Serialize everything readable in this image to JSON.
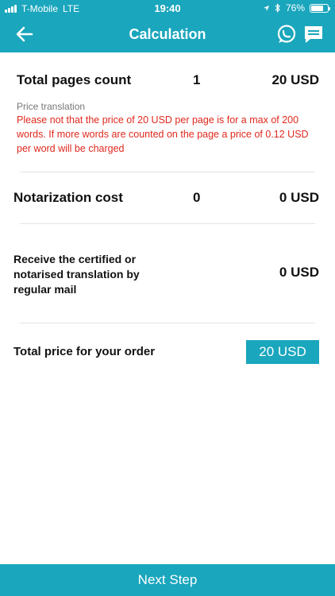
{
  "status": {
    "carrier": "T-Mobile",
    "network": "LTE",
    "time": "19:40",
    "battery": "76%",
    "battery_level": 0.76
  },
  "header": {
    "title": "Calculation",
    "back_icon": "arrow-left-icon",
    "icons": [
      "chat-bubble-icon",
      "message-square-icon"
    ]
  },
  "rows": {
    "pages": {
      "label": "Total pages count",
      "qty": "1",
      "amount": "20 USD"
    },
    "note": {
      "title": "Price translation",
      "text": "Please not that the price of 20 USD per page is for a max of 200 words. If more words are counted on the page a price of 0.12 USD per word will be charged"
    },
    "notarization": {
      "label": "Notarization cost",
      "qty": "0",
      "amount": "0 USD"
    },
    "mail": {
      "label": "Receive the certified or notarised translation by regular mail",
      "amount": "0 USD"
    },
    "total": {
      "label": "Total price for your order",
      "amount": "20 USD"
    }
  },
  "footer": {
    "next_label": "Next Step"
  },
  "colors": {
    "accent": "#1aa6bd",
    "warning": "#e0281e"
  }
}
